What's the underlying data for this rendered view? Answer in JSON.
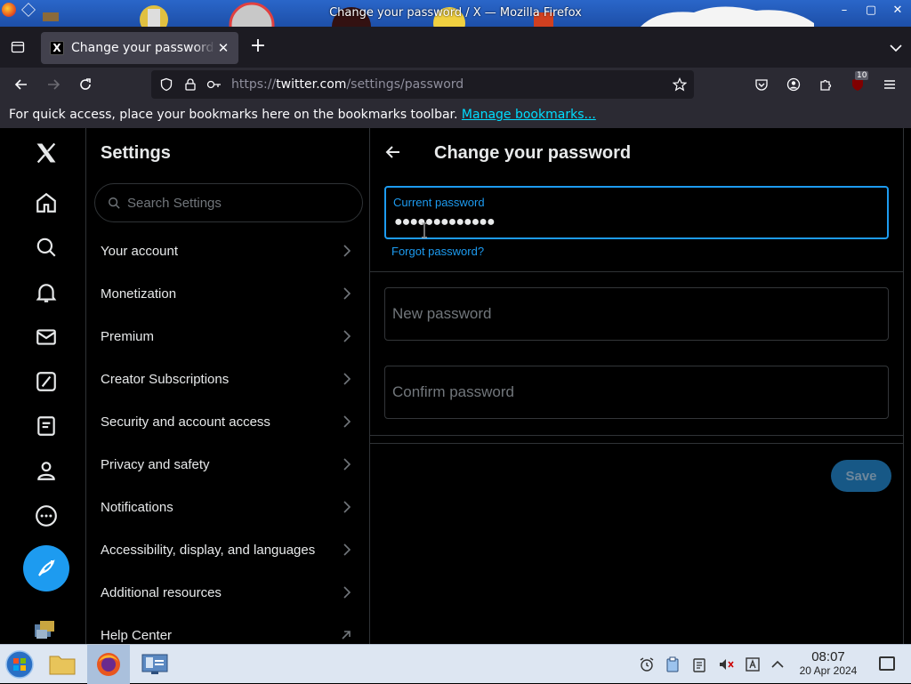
{
  "window": {
    "title": "Change your password / X — Mozilla Firefox",
    "controls": {
      "minimize": "–",
      "maximize": "▢",
      "close": "✕"
    }
  },
  "tabs": [
    {
      "title": "Change your password / X",
      "favicon": "X",
      "close": "✕",
      "active": true
    }
  ],
  "tabstrip": {
    "new_tab": "+"
  },
  "navbar": {
    "url_prefix": "https://",
    "url_host": "twitter.com",
    "url_path": "/settings/password",
    "extensions_badge": "10"
  },
  "bookmarks_bar": {
    "message": "For quick access, place your bookmarks here on the bookmarks toolbar.",
    "link": "Manage bookmarks..."
  },
  "settings": {
    "heading": "Settings",
    "search_placeholder": "Search Settings",
    "items": [
      {
        "label": "Your account",
        "icon": "chevron-right-icon"
      },
      {
        "label": "Monetization",
        "icon": "chevron-right-icon"
      },
      {
        "label": "Premium",
        "icon": "chevron-right-icon"
      },
      {
        "label": "Creator Subscriptions",
        "icon": "chevron-right-icon"
      },
      {
        "label": "Security and account access",
        "icon": "chevron-right-icon"
      },
      {
        "label": "Privacy and safety",
        "icon": "chevron-right-icon"
      },
      {
        "label": "Notifications",
        "icon": "chevron-right-icon"
      },
      {
        "label": "Accessibility, display, and languages",
        "icon": "chevron-right-icon"
      },
      {
        "label": "Additional resources",
        "icon": "chevron-right-icon"
      },
      {
        "label": "Help Center",
        "icon": "external-link-icon"
      }
    ]
  },
  "main": {
    "title": "Change your password",
    "current_password": {
      "label": "Current password",
      "value": "●●●●●●●●●●●●●"
    },
    "forgot_link": "Forgot password?",
    "new_password_placeholder": "New password",
    "confirm_password_placeholder": "Confirm password",
    "save_label": "Save"
  },
  "taskbar": {
    "time": "08:07",
    "date": "20 Apr 2024"
  },
  "colors": {
    "accent": "#1d9bf0",
    "background": "#000000",
    "text_primary": "#e7e9ea",
    "text_secondary": "#71767b",
    "border": "#2f3336"
  }
}
